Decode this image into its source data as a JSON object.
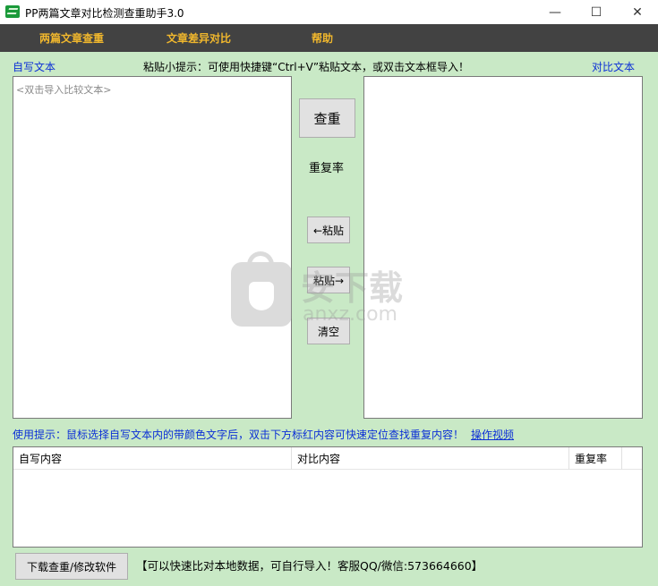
{
  "window": {
    "title": "PP两篇文章对比检测查重助手3.0",
    "minimize": "—",
    "maximize": "☐",
    "close": "✕"
  },
  "menu": {
    "items": [
      "两篇文章查重",
      "文章差异对比",
      "帮助"
    ],
    "color": "#f0b72d"
  },
  "left_label": "自写文本",
  "right_label": "对比文本",
  "paste_hint": "粘贴小提示：可使用快捷键“Ctrl+V”粘贴文本，或双击文本框导入！",
  "left_placeholder": "<双击导入比较文本>",
  "buttons": {
    "check": "查重",
    "paste_left": "←粘贴",
    "paste_right": "粘贴→",
    "clear": "清空",
    "download": "下载查重/修改软件"
  },
  "rate_label": "重复率",
  "usage_hint": "使用提示：鼠标选择自写文本内的带颜色文字后，双击下方标红内容可快速定位查找重复内容！",
  "video_link": "操作视频",
  "table": {
    "columns": [
      "自写内容",
      "对比内容",
      "重复率"
    ]
  },
  "bottom_note": "【可以快速比对本地数据，可自行导入！客服QQ/微信:573664660】",
  "watermark": {
    "main": "安下载",
    "sub": "anxz.com"
  }
}
